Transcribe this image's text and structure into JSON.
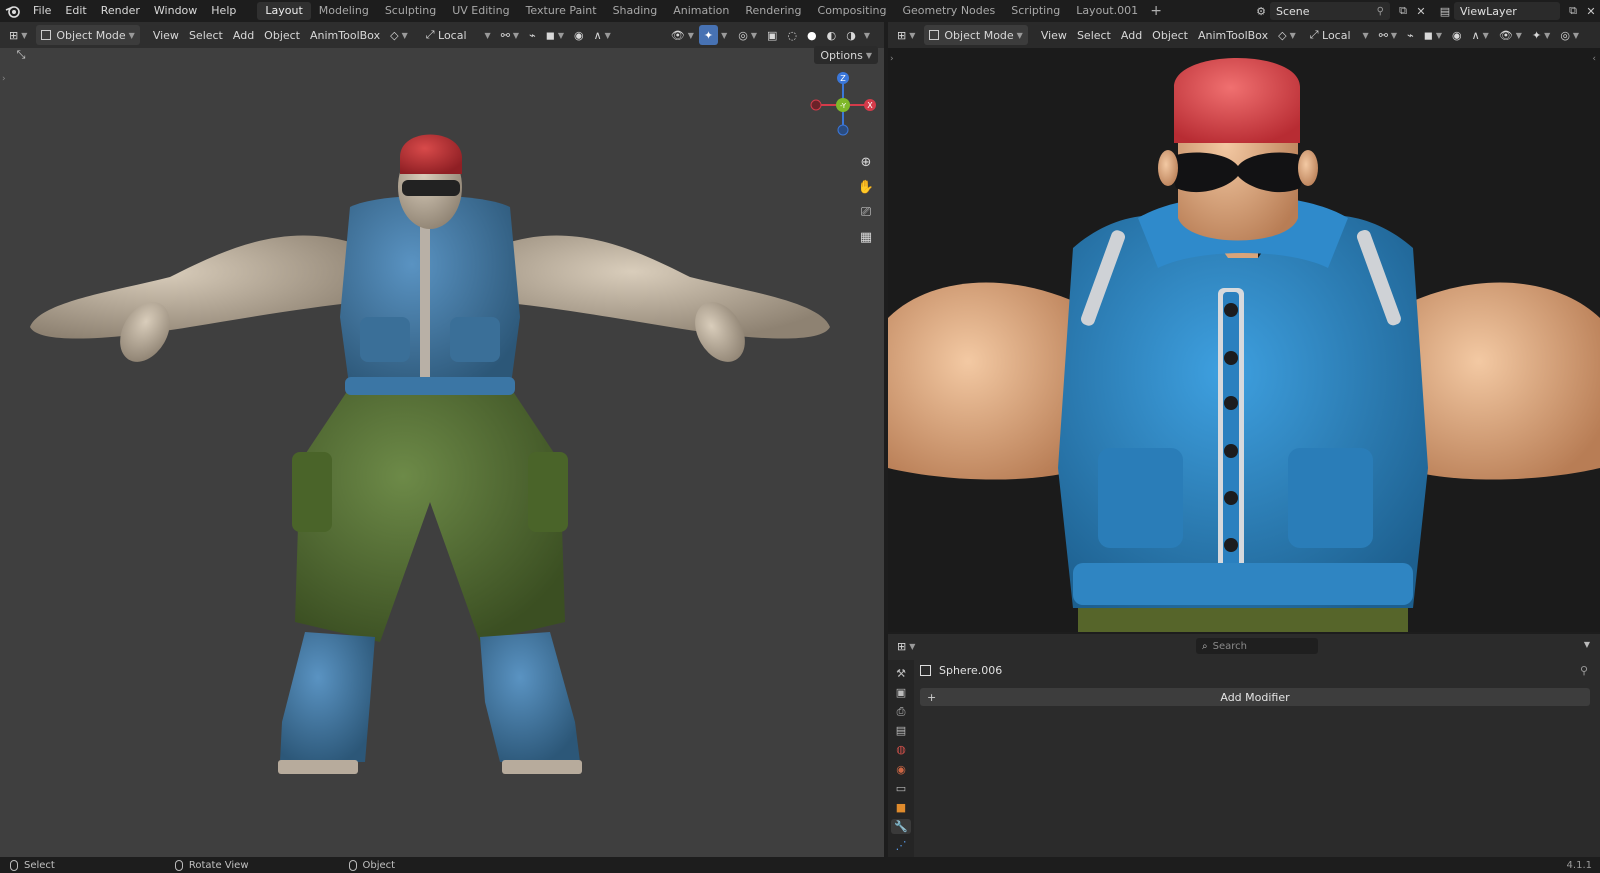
{
  "menu": [
    "File",
    "Edit",
    "Render",
    "Window",
    "Help"
  ],
  "workspace_tabs": [
    "Layout",
    "Modeling",
    "Sculpting",
    "UV Editing",
    "Texture Paint",
    "Shading",
    "Animation",
    "Rendering",
    "Compositing",
    "Geometry Nodes",
    "Scripting",
    "Layout.001"
  ],
  "active_workspace": "Layout",
  "scene": "Scene",
  "view_layer": "ViewLayer",
  "viewport_left": {
    "mode": "Object Mode",
    "menus": [
      "View",
      "Select",
      "Add",
      "Object",
      "AnimToolBox"
    ],
    "orientation": "Local",
    "options_label": "Options",
    "gizmo": {
      "z": "Z",
      "y": "-Y",
      "x": "X"
    }
  },
  "viewport_right": {
    "mode": "Object Mode",
    "menus": [
      "View",
      "Select",
      "Add",
      "Object",
      "AnimToolBox"
    ],
    "orientation": "Local"
  },
  "properties": {
    "search_placeholder": "Search",
    "object_name": "Sphere.006",
    "add_modifier": "Add Modifier"
  },
  "status": {
    "select": "Select",
    "rotate": "Rotate View",
    "object": "Object",
    "version": "4.1.1"
  },
  "colors": {
    "hair": "#c8343a",
    "vest": "#2f7fb5",
    "pants": "#4f6a30",
    "skin_clay": "#c9bcaa",
    "skin_render": "#e8b48b",
    "accent": "#4772b3"
  }
}
